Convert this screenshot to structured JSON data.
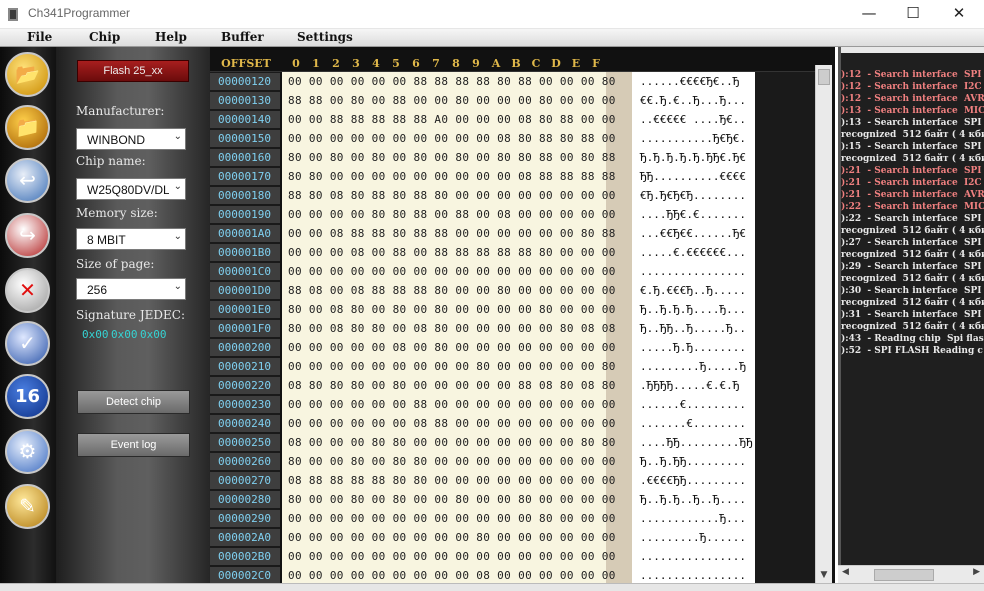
{
  "window": {
    "title": "Ch341Programmer",
    "minimize": "—",
    "maximize": "☐",
    "close": "✕"
  },
  "menu": [
    "File",
    "Chip",
    "Help",
    "Buffer",
    "Settings"
  ],
  "tools": [
    "open-folder-icon",
    "save-folder-icon",
    "read-chip-icon",
    "write-chip-icon",
    "erase-chip-icon",
    "verify-chip-icon",
    "chip-16-icon",
    "auto-program-icon",
    "edit-script-icon"
  ],
  "tool_sym": [
    "📂",
    "📁",
    "↩",
    "↪",
    "✕",
    "✓",
    "16",
    "⚙",
    "✎"
  ],
  "left": {
    "flash_button": "Flash 25_xx",
    "manufacturer_label": "Manufacturer:",
    "manufacturer_value": "WINBOND",
    "chip_label": "Chip name:",
    "chip_value": "W25Q80DV/DL",
    "memory_label": "Memory size:",
    "memory_value": "8 MBIT",
    "page_label": "Size of page:",
    "page_value": "256",
    "jedec_label": "Signature JEDEC:",
    "jedec": [
      "0x00",
      "0x00",
      "0x00"
    ],
    "detect_button": "Detect chip",
    "eventlog_button": "Event log"
  },
  "hex": {
    "offset_label": "OFFSET",
    "columns": [
      "0",
      "1",
      "2",
      "3",
      "4",
      "5",
      "6",
      "7",
      "8",
      "9",
      "A",
      "B",
      "C",
      "D",
      "E",
      "F"
    ],
    "rows": [
      {
        "addr": "00000120",
        "bytes": "00 00 00 00 00 00 88 88 88 88 80 88 00 00 00 80",
        "ascii": "......€€€€Ђ€..Ђ"
      },
      {
        "addr": "00000130",
        "bytes": "88 88 00 80 00 88 00 00 80 00 00 00 80 00 00 00",
        "ascii": "€€.Ђ.€..Ђ...Ђ..."
      },
      {
        "addr": "00000140",
        "bytes": "00 00 88 88 88 88 88 A0 00 00 00 08 80 88 00 00",
        "ascii": "..€€€€€ ....Ђ€.."
      },
      {
        "addr": "00000150",
        "bytes": "00 00 00 00 00 00 00 00 00 00 08 80 88 80 88 00",
        "ascii": "...........Ђ€Ђ€."
      },
      {
        "addr": "00000160",
        "bytes": "80 00 80 00 80 00 80 00 80 00 80 80 88 00 80 88",
        "ascii": "Ђ.Ђ.Ђ.Ђ.Ђ.ЂЂ€.Ђ€"
      },
      {
        "addr": "00000170",
        "bytes": "80 80 00 00 00 00 00 00 00 00 00 08 88 88 88 88",
        "ascii": "ЂЂ..........€€€€"
      },
      {
        "addr": "00000180",
        "bytes": "88 80 08 80 88 80 88 80 00 00 00 00 00 00 00 00",
        "ascii": "€Ђ.Ђ€Ђ€Ђ........"
      },
      {
        "addr": "00000190",
        "bytes": "00 00 00 00 80 80 88 00 88 00 08 00 00 00 00 00",
        "ascii": "....ЂЂ€.€......."
      },
      {
        "addr": "000001A0",
        "bytes": "00 00 08 88 88 80 88 88 00 00 00 00 00 00 80 88",
        "ascii": "...€€Ђ€€......Ђ€"
      },
      {
        "addr": "000001B0",
        "bytes": "00 00 00 08 00 88 00 88 88 88 88 88 80 00 00 00",
        "ascii": ".....€.€€€€€€..."
      },
      {
        "addr": "000001C0",
        "bytes": "00 00 00 00 00 00 00 00 00 00 00 00 00 00 00 00",
        "ascii": "................"
      },
      {
        "addr": "000001D0",
        "bytes": "88 08 00 08 88 88 88 80 00 00 80 00 00 00 00 00",
        "ascii": "€.Ђ.€€€Ђ..Ђ....."
      },
      {
        "addr": "000001E0",
        "bytes": "80 00 08 80 00 80 00 80 00 00 00 00 80 00 00 00",
        "ascii": "Ђ..Ђ.Ђ.Ђ....Ђ..."
      },
      {
        "addr": "000001F0",
        "bytes": "80 00 08 80 80 00 08 80 00 00 00 00 00 80 08 08",
        "ascii": "Ђ..ЂЂ..Ђ.....Ђ.."
      },
      {
        "addr": "00000200",
        "bytes": "00 00 00 00 00 08 00 80 00 00 00 00 00 00 00 00",
        "ascii": ".....Ђ.Ђ........"
      },
      {
        "addr": "00000210",
        "bytes": "00 00 00 00 00 00 00 00 00 80 00 00 00 00 00 80",
        "ascii": ".........Ђ.....Ђ"
      },
      {
        "addr": "00000220",
        "bytes": "08 80 80 80 00 80 00 00 00 00 00 88 08 80 08 80",
        "ascii": ".ЂЂЂЂ.....€.€.Ђ"
      },
      {
        "addr": "00000230",
        "bytes": "00 00 00 00 00 00 88 00 00 00 00 00 00 00 00 00",
        "ascii": "......€........."
      },
      {
        "addr": "00000240",
        "bytes": "00 00 00 00 00 00 08 88 00 00 00 00 00 00 00 00",
        "ascii": ".......€........"
      },
      {
        "addr": "00000250",
        "bytes": "08 00 00 00 80 80 00 00 00 00 00 00 00 00 80 80",
        "ascii": "....ЂЂ.........ЂЂ"
      },
      {
        "addr": "00000260",
        "bytes": "80 00 00 80 00 80 80 00 00 00 00 00 00 00 00 00",
        "ascii": "Ђ..Ђ.ЂЂ........."
      },
      {
        "addr": "00000270",
        "bytes": "08 88 88 88 88 80 80 00 00 00 00 00 00 00 00 00",
        "ascii": ".€€€€ЂЂ........."
      },
      {
        "addr": "00000280",
        "bytes": "80 00 00 80 00 80 00 00 80 00 00 80 00 00 00 00",
        "ascii": "Ђ..Ђ.Ђ..Ђ..Ђ...."
      },
      {
        "addr": "00000290",
        "bytes": "00 00 00 00 00 00 00 00 00 00 00 00 80 00 00 00",
        "ascii": "............Ђ..."
      },
      {
        "addr": "000002A0",
        "bytes": "00 00 00 00 00 00 00 00 00 80 00 00 00 00 00 00",
        "ascii": ".........Ђ......"
      },
      {
        "addr": "000002B0",
        "bytes": "00 00 00 00 00 00 00 00 00 00 00 00 00 00 00 00",
        "ascii": "................"
      },
      {
        "addr": "000002C0",
        "bytes": "00 00 00 00 00 00 00 00 00 08 00 00 00 00 00 00",
        "ascii": "................"
      }
    ]
  },
  "log": [
    {
      "text": "):12  - Search interface  SPI",
      "color": "#f08080"
    },
    {
      "text": "):12  - Search interface  I2C",
      "color": "#f08080"
    },
    {
      "text": "):12  - Search interface  AVR",
      "color": "#f08080"
    },
    {
      "text": "):13  - Search interface  MIC",
      "color": "#f08080"
    },
    {
      "text": "):13  - Search interface  SPI",
      "color": "#e8e8e8"
    },
    {
      "text": "recognized  512 байт ( 4 кбит",
      "color": "#e8e8e8"
    },
    {
      "text": "):15  - Search interface  SPI",
      "color": "#e8e8e8"
    },
    {
      "text": "recognized  512 байт ( 4 кбит",
      "color": "#e8e8e8"
    },
    {
      "text": "):21  - Search interface  SPI",
      "color": "#f08080"
    },
    {
      "text": "):21  - Search interface  I2C",
      "color": "#f08080"
    },
    {
      "text": "):21  - Search interface  AVR",
      "color": "#f08080"
    },
    {
      "text": "):22  - Search interface  MIC",
      "color": "#f08080"
    },
    {
      "text": "):22  - Search interface  SPI",
      "color": "#e8e8e8"
    },
    {
      "text": "recognized  512 байт ( 4 кбит",
      "color": "#e8e8e8"
    },
    {
      "text": "):27  - Search interface  SPI",
      "color": "#e8e8e8"
    },
    {
      "text": "recognized  512 байт ( 4 кбит",
      "color": "#e8e8e8"
    },
    {
      "text": "):29  - Search interface  SPI",
      "color": "#e8e8e8"
    },
    {
      "text": "recognized  512 байт ( 4 кбит",
      "color": "#e8e8e8"
    },
    {
      "text": "):30  - Search interface  SPI",
      "color": "#e8e8e8"
    },
    {
      "text": "recognized  512 байт ( 4 кбит",
      "color": "#e8e8e8"
    },
    {
      "text": "):31  - Search interface  SPI",
      "color": "#e8e8e8"
    },
    {
      "text": "recognized  512 байт ( 4 кбит",
      "color": "#e8e8e8"
    },
    {
      "text": "):43  - Reading chip  Spi flas",
      "color": "#e8e8e8"
    },
    {
      "text": "):52  - SPI FLASH Reading c",
      "color": "#e8e8e8"
    }
  ]
}
